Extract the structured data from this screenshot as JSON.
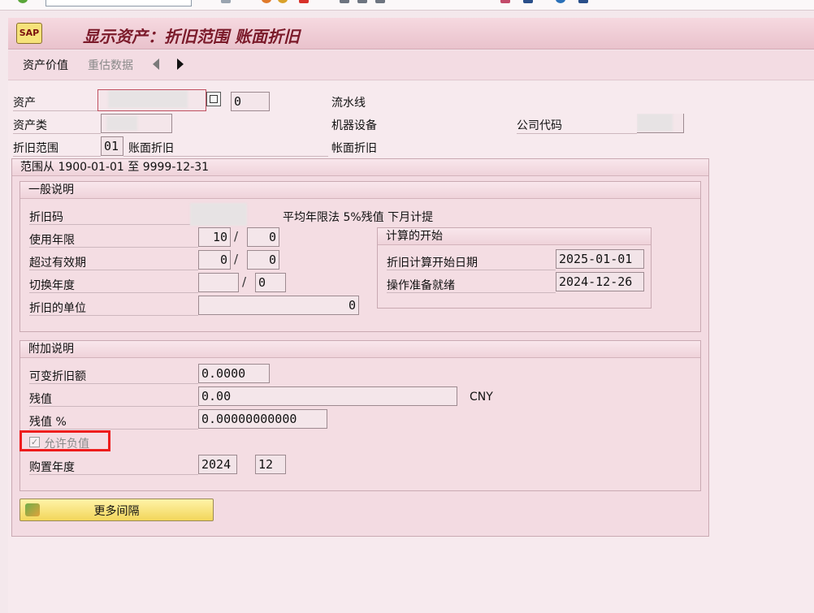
{
  "window": {
    "title": "显示资产：折旧范围 账面折旧"
  },
  "toolbar": {
    "asset_value": "资产价值",
    "revaluation_data": "重估数据"
  },
  "header": {
    "asset_label": "资产",
    "asset_sub_number": "0",
    "asset_description": "流水线",
    "asset_class_label": "资产类",
    "asset_class_description": "机器设备",
    "company_code_label": "公司代码",
    "depr_area_label": "折旧范围",
    "depr_area_code": "01",
    "depr_area_name": "账面折旧",
    "depr_area_name2": "帐面折旧"
  },
  "range": {
    "text": "范围从 1900-01-01 至 9999-12-31"
  },
  "general": {
    "title": "一般说明",
    "depr_key_label": "折旧码",
    "depr_key_text": "平均年限法 5%残值 下月计提",
    "useful_life_label": "使用年限",
    "useful_life_years": "10",
    "useful_life_periods": "0",
    "expired_life_label": "超过有效期",
    "expired_years": "0",
    "expired_periods": "0",
    "changeover_label": "切换年度",
    "changeover_year": "",
    "changeover_period": "0",
    "depr_units_label": "折旧的单位",
    "depr_units": "0"
  },
  "calc_start": {
    "title": "计算的开始",
    "odep_start_label": "折旧计算开始日期",
    "odep_start_date": "2025-01-01",
    "ready_label": "操作准备就绪",
    "ready_date": "2024-12-26"
  },
  "additional": {
    "title": "附加说明",
    "var_depr_label": "可变折旧额",
    "var_depr_value": "0.0000",
    "scrap_label": "残值",
    "scrap_value": "0.00",
    "currency": "CNY",
    "scrap_pct_label": "残值 %",
    "scrap_pct_value": "0.00000000000",
    "neg_values_label": "允许负值",
    "neg_values_checked": true,
    "acq_year_label": "购置年度",
    "acq_year": "2024",
    "acq_period": "12"
  },
  "more_intervals": {
    "label": "更多间隔"
  },
  "icons": {
    "title": "sap-display-icon",
    "back": "arrow-left-icon",
    "forward": "arrow-right-icon",
    "more": "more-intervals-icon",
    "copy": "copy-icon"
  },
  "colors": {
    "highlight": "#ee1c1c",
    "title_text": "#7b1a2a",
    "button": "#f2d65a"
  }
}
